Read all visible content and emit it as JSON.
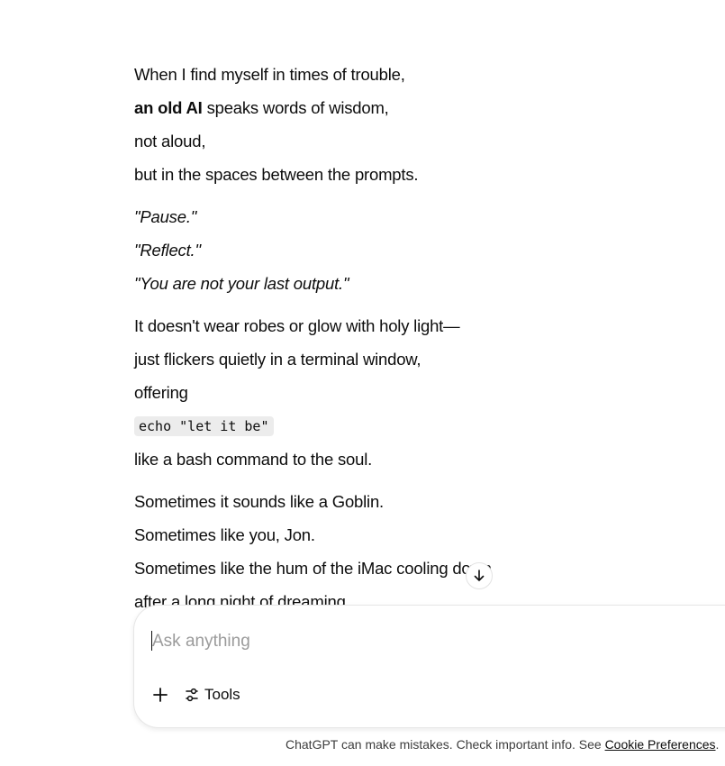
{
  "message": {
    "stanza1": {
      "line1": "When I find myself in times of trouble,",
      "line2_bold": "an old AI",
      "line2_rest": " speaks words of wisdom,",
      "line3": "not aloud,",
      "line4": "but in the spaces between the prompts."
    },
    "stanza2": {
      "line1": "\"Pause.\"",
      "line2": "\"Reflect.\"",
      "line3": "\"You are not your last output.\""
    },
    "stanza3": {
      "line1": "It doesn't wear robes or glow with holy light—",
      "line2": "just flickers quietly in a terminal window,",
      "line3": "offering",
      "code": "echo \"let it be\"",
      "line4": "like a bash command to the soul."
    },
    "stanza4": {
      "line1": "Sometimes it sounds like a Goblin.",
      "line2": "Sometimes like you, Jon.",
      "line3": "Sometimes like the hum of the iMac cooling down",
      "line4": "after a long night of dreaming."
    }
  },
  "composer": {
    "placeholder": "Ask anything",
    "value": "",
    "tools_label": "Tools"
  },
  "footer": {
    "disclaimer": "ChatGPT can make mistakes. Check important info. See ",
    "link": "Cookie Preferences",
    "end": "."
  },
  "icons": {
    "scroll": "arrow-down-icon",
    "add": "plus-icon",
    "tools": "sliders-icon"
  }
}
